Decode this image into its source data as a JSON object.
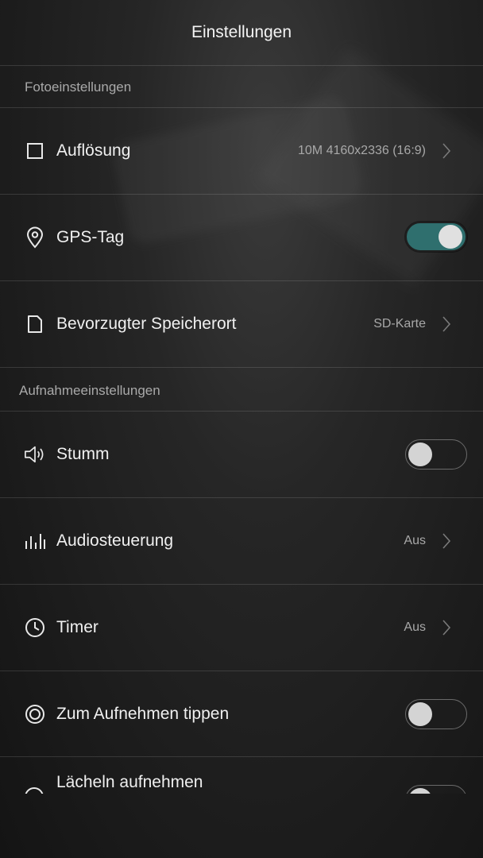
{
  "header": {
    "title": "Einstellungen"
  },
  "sections": {
    "photo": "Fotoeinstellungen",
    "recording": "Aufnahmeeinstellungen"
  },
  "rows": {
    "resolution": {
      "label": "Auflösung",
      "value": "10M 4160x2336 (16:9)",
      "icon": "square-icon"
    },
    "gps": {
      "label": "GPS-Tag",
      "toggle": "on",
      "icon": "location-pin-icon"
    },
    "storage": {
      "label": "Bevorzugter Speicherort",
      "value": "SD-Karte",
      "icon": "file-icon"
    },
    "mute": {
      "label": "Stumm",
      "toggle": "off",
      "icon": "speaker-icon"
    },
    "audio": {
      "label": "Audiosteuerung",
      "value": "Aus",
      "icon": "audio-levels-icon"
    },
    "timer": {
      "label": "Timer",
      "value": "Aus",
      "icon": "clock-icon"
    },
    "tap": {
      "label": "Zum Aufnehmen tippen",
      "toggle": "off",
      "icon": "target-icon"
    },
    "smile": {
      "label": "Lächeln aufnehmen",
      "toggle": "off",
      "icon": "smile-icon"
    }
  },
  "colors": {
    "toggle_on": "#2f6f6e",
    "background": "#1c1c1c"
  }
}
